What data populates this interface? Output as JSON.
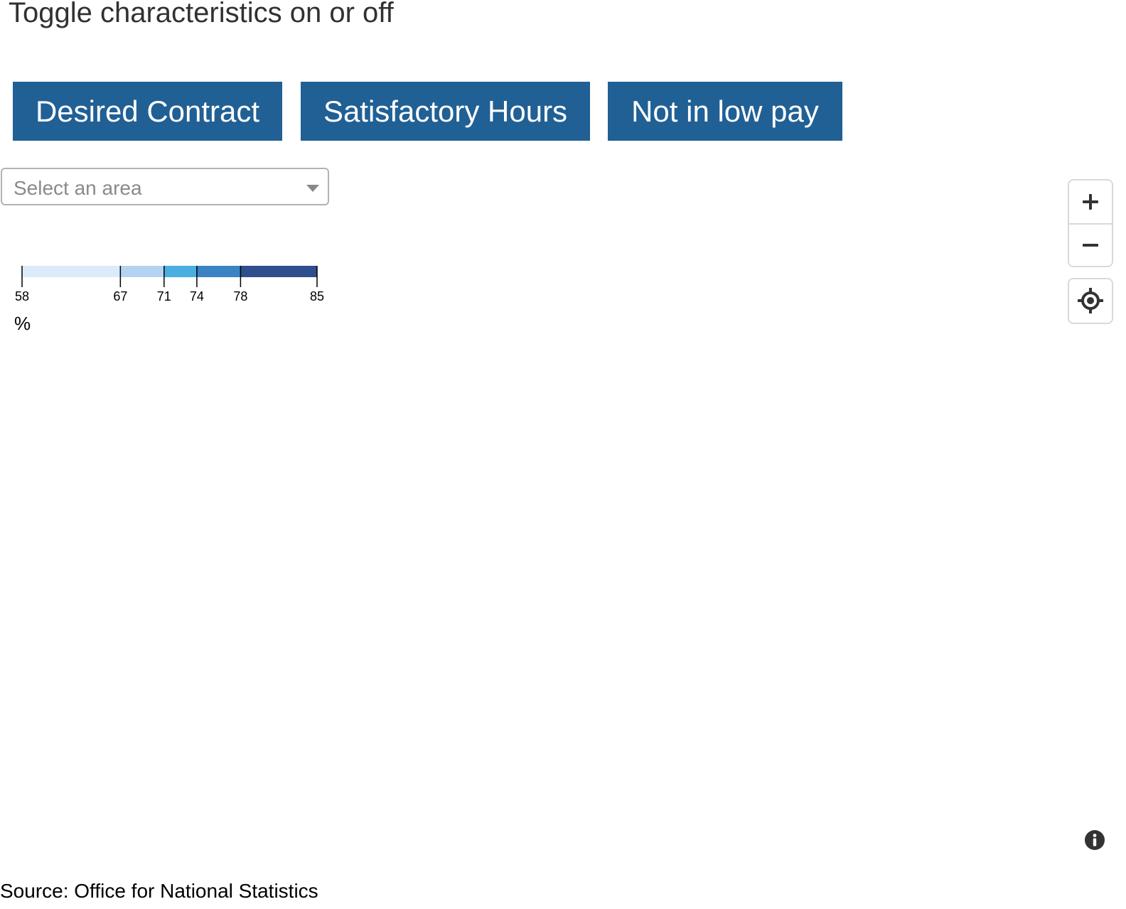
{
  "heading": "Toggle characteristics on or off",
  "toggles": [
    {
      "label": "Desired Contract"
    },
    {
      "label": "Satisfactory Hours"
    },
    {
      "label": "Not in low pay"
    }
  ],
  "toggle_color": "#206095",
  "area_select": {
    "placeholder": "Select an area",
    "icon": "chevron-down-icon"
  },
  "legend": {
    "breaks": [
      58,
      67,
      71,
      74,
      78,
      85
    ],
    "tick_labels": [
      "58",
      "67",
      "71",
      "74",
      "78",
      "85"
    ],
    "colors": [
      "#dcebfa",
      "#b4d3f0",
      "#4aaee0",
      "#3a84c4",
      "#2e4e8c"
    ],
    "unit": "%"
  },
  "map_controls": {
    "zoom_in_icon": "plus-icon",
    "zoom_out_icon": "minus-icon",
    "locate_icon": "crosshair-icon",
    "info_icon": "info-icon"
  },
  "source": "Source: Office for National Statistics"
}
